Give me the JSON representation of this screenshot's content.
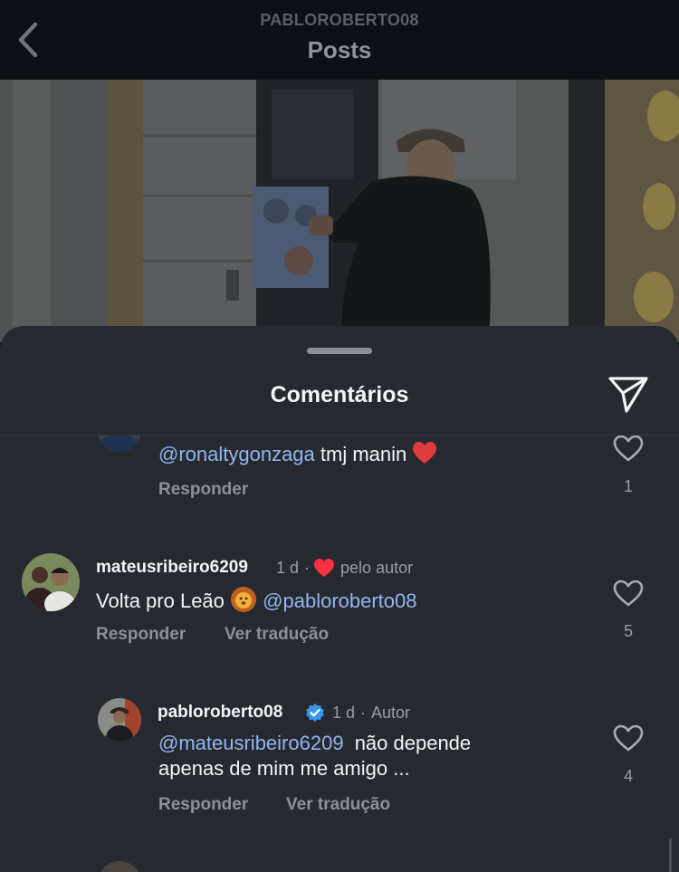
{
  "header": {
    "username": "PABLOROBERTO08",
    "title": "Posts"
  },
  "sheet": {
    "title": "Comentários"
  },
  "comments": [
    {
      "text_mention": "@ronaltygonzaga",
      "text": "tmj manin",
      "reply_label": "Responder",
      "likes": "1"
    },
    {
      "username": "mateusribeiro6209",
      "time": "1 d",
      "separator": "·",
      "liked_by_author_label": "pelo autor",
      "text": "Volta pro Leão",
      "text_mention": "@pabloroberto08",
      "reply_label": "Responder",
      "translate_label": "Ver tradução",
      "likes": "5"
    },
    {
      "username": "pabloroberto08",
      "time": "1 d",
      "separator": "·",
      "author_label": "Autor",
      "text_mention": "@mateusribeiro6209",
      "text_line1": "não depende",
      "text_line2": "apenas de mim me amigo ...",
      "reply_label": "Responder",
      "translate_label": "Ver tradução",
      "likes": "4"
    }
  ],
  "icons": {
    "back": "chevron-left-icon",
    "share": "paper-plane-icon",
    "like": "heart-outline-icon",
    "verified": "verified-badge-icon",
    "liked_by_author": "heart-filled-icon"
  },
  "colors": {
    "mention": "#93b6f0",
    "verified": "#3897f0",
    "heart": "#ff3040"
  }
}
